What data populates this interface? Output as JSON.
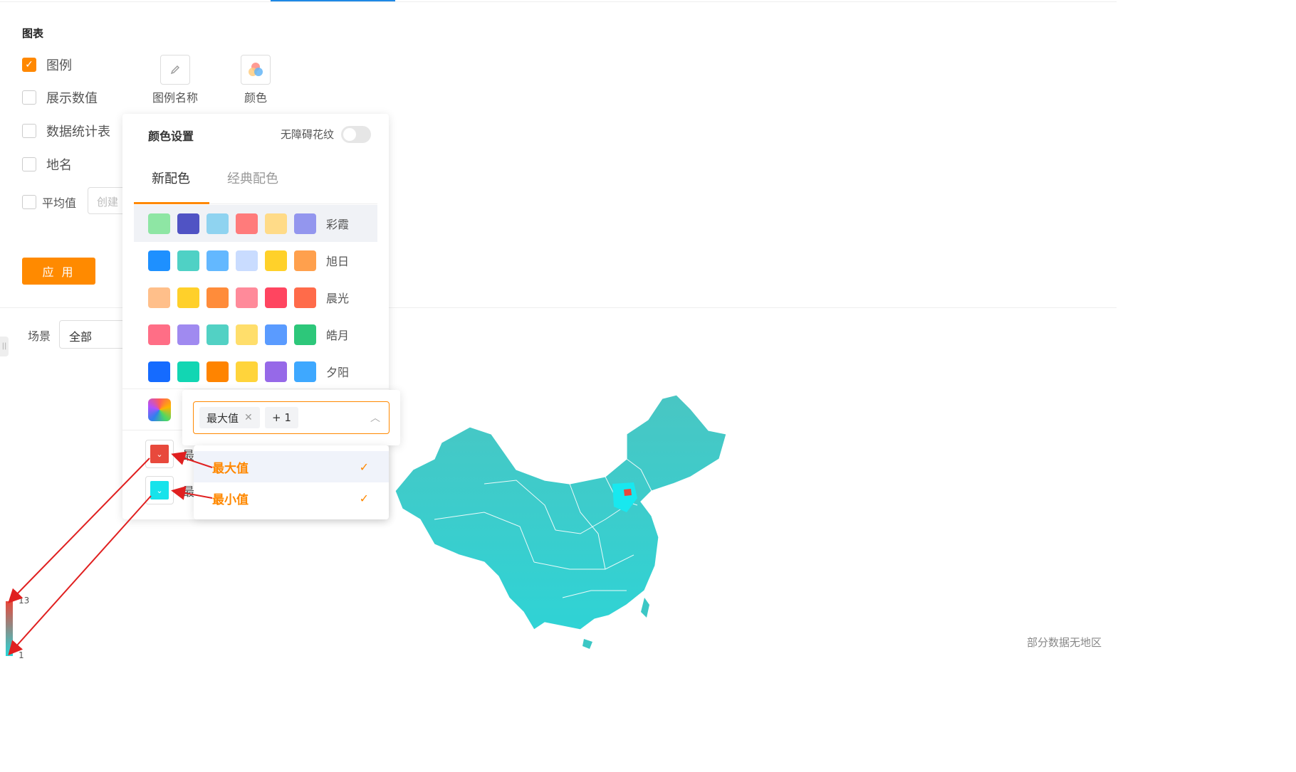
{
  "chart_section": {
    "title": "图表",
    "checkboxes": [
      {
        "label": "图例",
        "checked": true
      },
      {
        "label": "展示数值",
        "checked": false
      },
      {
        "label": "数据统计表",
        "checked": false
      },
      {
        "label": "地名",
        "checked": false
      },
      {
        "label": "平均值",
        "checked": false
      }
    ],
    "avg_placeholder": "创建",
    "tools": [
      {
        "label": "图例名称",
        "icon": "pencil-icon"
      },
      {
        "label": "颜色",
        "icon": "color-circles-icon"
      }
    ],
    "apply_label": "应 用"
  },
  "scene": {
    "label": "场景",
    "value": "全部"
  },
  "color_panel": {
    "title": "颜色设置",
    "toggle_label": "无障碍花纹",
    "toggle_on": false,
    "tabs": [
      {
        "label": "新配色",
        "active": true
      },
      {
        "label": "经典配色",
        "active": false
      }
    ],
    "palettes": [
      {
        "name": "彩霞",
        "colors": [
          "#8ee6a4",
          "#5053c4",
          "#8fd3f0",
          "#ff7b7b",
          "#ffdb88",
          "#9396ee"
        ],
        "selected": true
      },
      {
        "name": "旭日",
        "colors": [
          "#1e90ff",
          "#4fd1c5",
          "#63b8ff",
          "#c9dcff",
          "#ffd12a",
          "#ffa04d"
        ],
        "selected": false
      },
      {
        "name": "晨光",
        "colors": [
          "#ffbf8a",
          "#ffd02a",
          "#ff8c3a",
          "#ff8a9a",
          "#ff4560",
          "#ff6b4a"
        ],
        "selected": false
      },
      {
        "name": "皓月",
        "colors": [
          "#ff6e86",
          "#a08af0",
          "#52d1c4",
          "#ffde6b",
          "#5a9bff",
          "#2dc77a"
        ],
        "selected": false
      },
      {
        "name": "夕阳",
        "colors": [
          "#156bff",
          "#12d6b3",
          "#ff8400",
          "#ffd43b",
          "#9669e8",
          "#3ea8ff"
        ],
        "selected": false
      }
    ],
    "custom_label": "",
    "pickers": [
      {
        "label": "最",
        "color": "#e8493c",
        "icon": "chevron-down-icon"
      },
      {
        "label": "最",
        "color": "#17e3eb",
        "icon": "chevron-down-icon"
      }
    ]
  },
  "value_select": {
    "tags": [
      "最大值",
      "+ 1"
    ],
    "options": [
      {
        "label": "最大值",
        "checked": true
      },
      {
        "label": "最小值",
        "checked": true
      }
    ]
  },
  "legend": {
    "max": "13",
    "min": "1",
    "max_color": "#e8493c",
    "min_color": "#27d6d8"
  },
  "map": {
    "note": "部分数据无地区",
    "base_color": "#3cc7c5",
    "highlight_color": "#e8493c"
  }
}
